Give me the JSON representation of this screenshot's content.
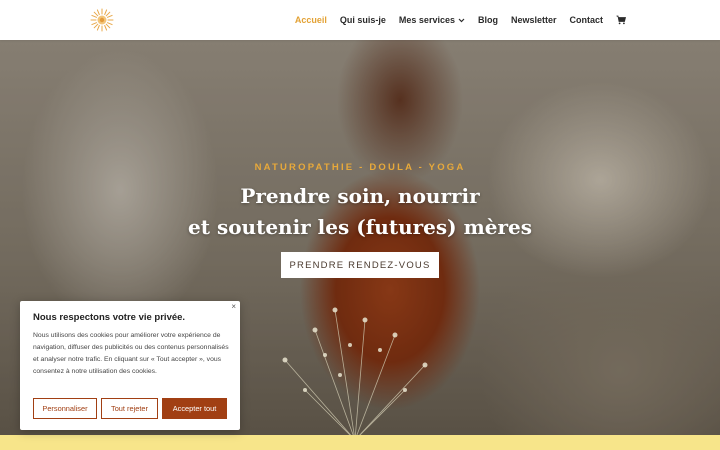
{
  "header": {
    "logo_icon": "sun-flower-logo-icon",
    "nav": [
      {
        "label": "Accueil",
        "active": true
      },
      {
        "label": "Qui suis-je"
      },
      {
        "label": "Mes services",
        "dropdown": true
      },
      {
        "label": "Blog"
      },
      {
        "label": "Newsletter"
      },
      {
        "label": "Contact"
      }
    ],
    "cart_icon": "shopping-cart-icon"
  },
  "hero": {
    "subtitle": "NATUROPATHIE - DOULA - YOGA",
    "title_line1": "Prendre soin, nourrir",
    "title_line2": "et soutenir les (futures) mères",
    "cta_label": "PRENDRE RENDEZ-VOUS"
  },
  "cookie": {
    "title": "Nous respectons votre vie privée.",
    "text": "Nous utilisons des cookies pour améliorer votre expérience de navigation, diffuser des publicités ou des contenus personnalisés et analyser notre trafic. En cliquant sur « Tout accepter », vous consentez à notre utilisation des cookies.",
    "close_label": "×",
    "personalize_label": "Personnaliser",
    "reject_label": "Tout rejeter",
    "accept_label": "Accepter tout"
  },
  "colors": {
    "accent": "#e3a235",
    "button_brown": "#a13f13",
    "band_yellow": "#f7e58a"
  }
}
